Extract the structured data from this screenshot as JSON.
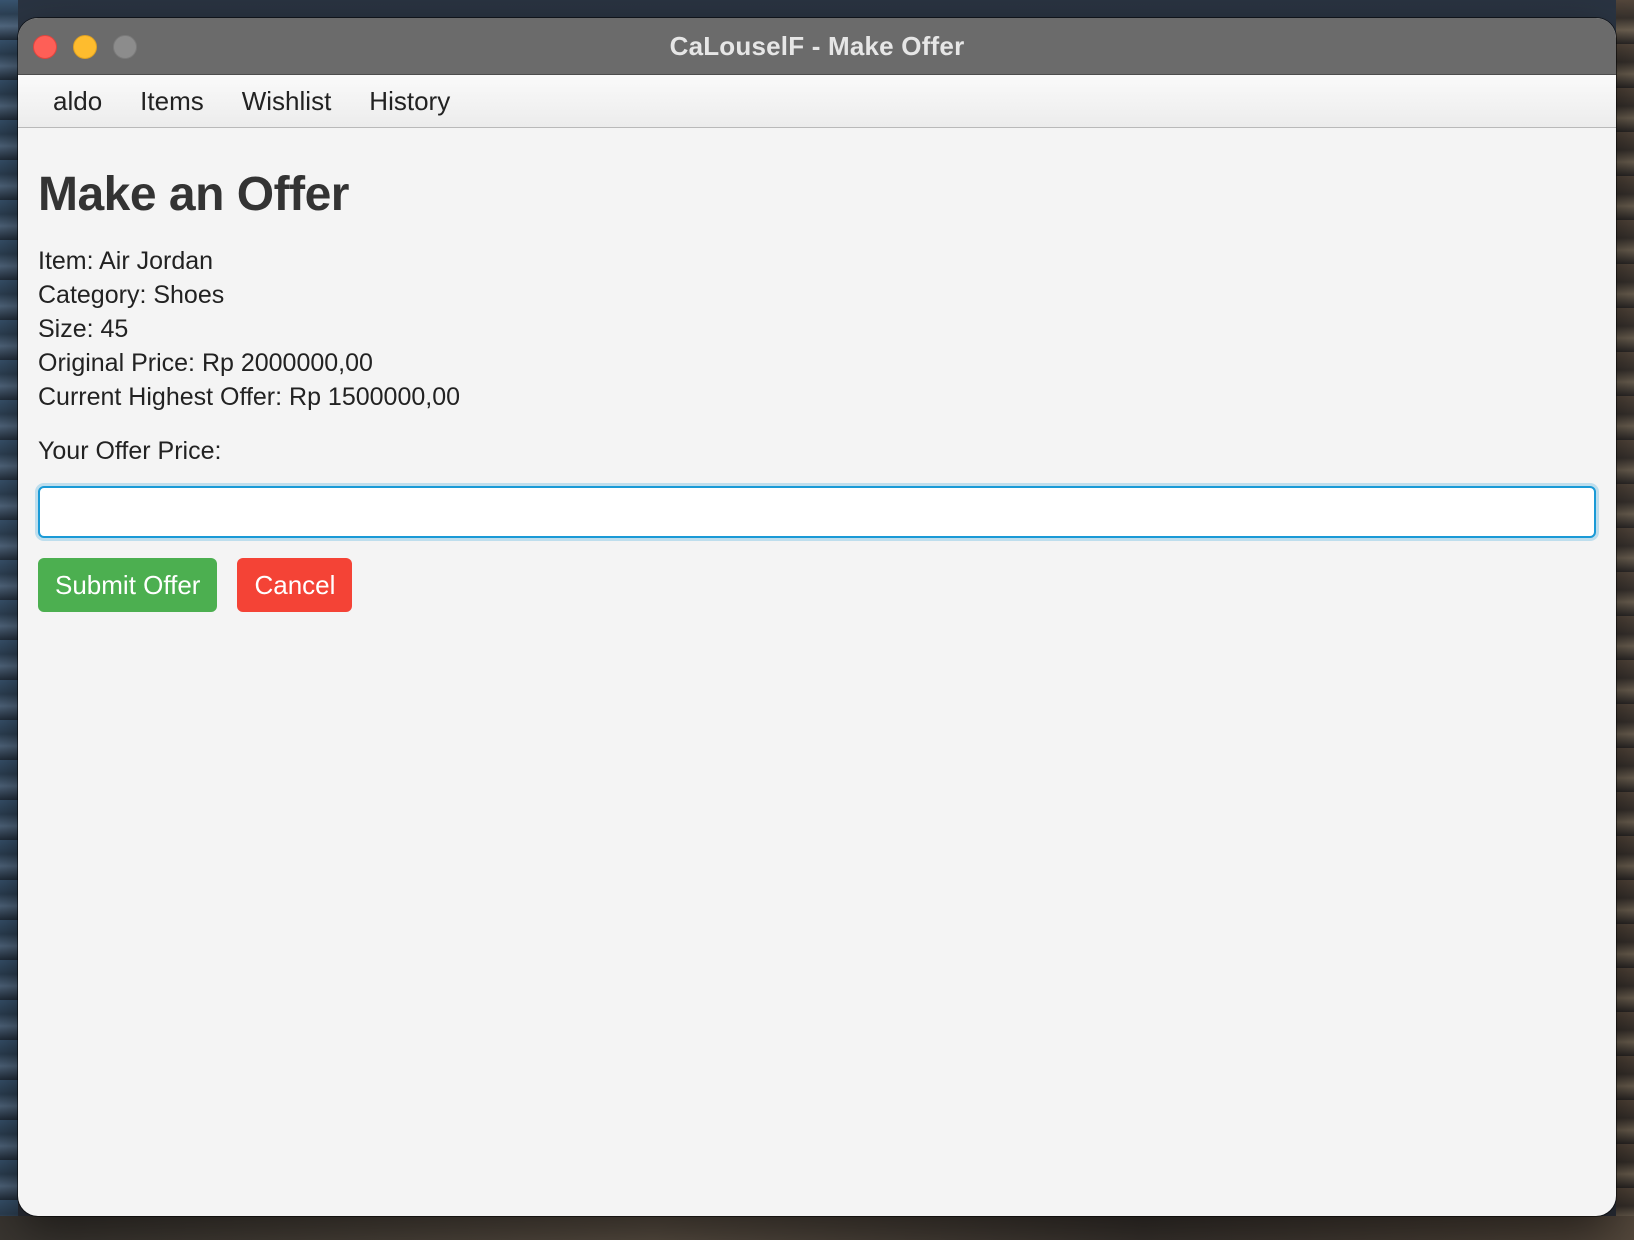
{
  "window": {
    "title": "CaLouselF - Make Offer"
  },
  "menubar": {
    "items": [
      {
        "label": "aldo"
      },
      {
        "label": "Items"
      },
      {
        "label": "Wishlist"
      },
      {
        "label": "History"
      }
    ]
  },
  "form": {
    "heading": "Make an Offer",
    "item_line": "Item: Air Jordan",
    "category_line": "Category: Shoes",
    "size_line": "Size: 45",
    "original_price_line": "Original Price: Rp 2000000,00",
    "highest_offer_line": "Current Highest Offer: Rp 1500000,00",
    "offer_label": "Your Offer Price:",
    "offer_value": "",
    "submit_label": "Submit Offer",
    "cancel_label": "Cancel"
  },
  "colors": {
    "submit_button": "#4caf50",
    "cancel_button": "#f44336",
    "input_focus_border": "#1a9ad6"
  }
}
